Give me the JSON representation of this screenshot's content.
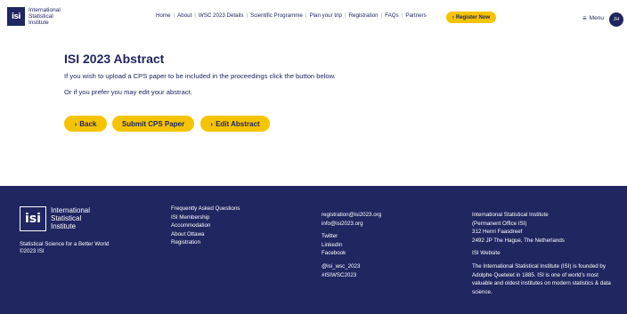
{
  "header": {
    "logo_mark": "isi",
    "logo_text": "International Statistical Institute",
    "nav": [
      "Home",
      "About",
      "WSC 2023 Details",
      "Scientific Programme",
      "Plan your trip",
      "Registration",
      "FAQs",
      "Partners"
    ],
    "register_label": "Register Now",
    "menu_label": "Menu",
    "avatar_initials": "JH"
  },
  "main": {
    "title": "ISI 2023 Abstract",
    "paragraph1": "If you wish to upload a CPS paper to be included in the proceedings click the button below.",
    "paragraph2": "Or if you prefer you may edit your abstract.",
    "back_label": "Back",
    "submit_label": "Submit CPS Paper",
    "edit_label": "Edit Abstract"
  },
  "footer": {
    "logo_mark": "isi",
    "logo_text": "International Statistical Institute",
    "tagline": "Statistical Science for a Better World",
    "copyright": "©2023 ISI",
    "links": [
      "Frequently Asked Questions",
      "ISI Membership",
      "Accommodation",
      "About Ottawa",
      "Registration"
    ],
    "emails": [
      "registration@isi2023.org",
      "info@isi2023.org"
    ],
    "social": [
      "Twitter",
      "LinkedIn",
      "Facebook"
    ],
    "handles": [
      "@isi_wsc_2023",
      "#ISIWSC2023"
    ],
    "address": [
      "International Statistical Institute",
      "(Permanent Office ISI)",
      "312 Henri Faasdreef",
      "2492 JP The Hague, The Netherlands"
    ],
    "website_label": "ISI Website",
    "about_text": "The International Statistical Institute (ISI) is founded by Adolphe Quetelet in 1885. ISI is one of world's most valuable and oldest institutes on modern statistics & data science."
  },
  "colors": {
    "navy": "#1f2660",
    "accent": "#f5c400"
  }
}
